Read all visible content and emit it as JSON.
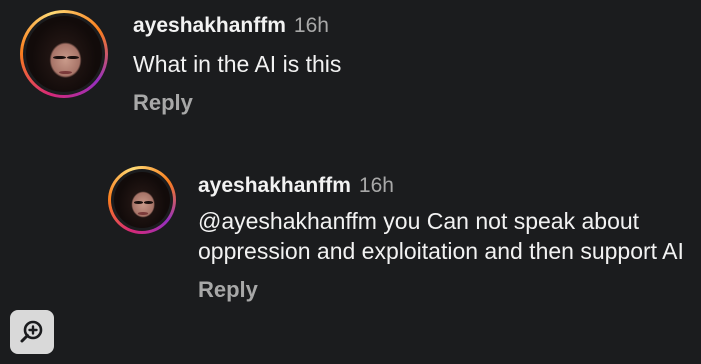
{
  "comments": [
    {
      "username": "ayeshakhanffm",
      "time": "16h",
      "text": "What in the AI is this",
      "reply_label": "Reply"
    },
    {
      "username": "ayeshakhanffm",
      "time": "16h",
      "text": "@ayeshakhanffm you Can not speak about oppression and exploitation and then support AI",
      "reply_label": "Reply"
    }
  ],
  "zoom_button": {
    "icon": "zoom-in-icon"
  }
}
